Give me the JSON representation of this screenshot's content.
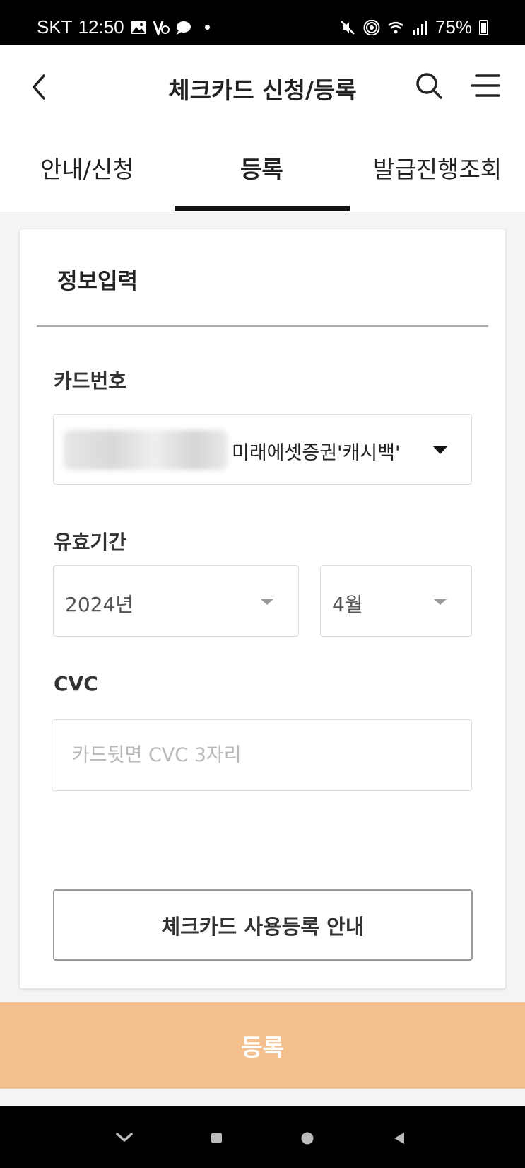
{
  "status_bar": {
    "carrier": "SKT",
    "time": "12:50",
    "battery": "75%",
    "left_icons": [
      "gallery-icon",
      "silent-mode-icon",
      "chat-bubble-icon",
      "notification-dot-icon"
    ],
    "right_icons": [
      "mute-icon",
      "hotspot-icon",
      "wifi-icon",
      "signal-icon",
      "battery-icon"
    ]
  },
  "header": {
    "title": "체크카드 신청/등록",
    "icons": [
      "back-icon",
      "search-icon",
      "menu-icon"
    ]
  },
  "tabs": [
    {
      "label": "안내/신청",
      "active": false
    },
    {
      "label": "등록",
      "active": true
    },
    {
      "label": "발급진행조회",
      "active": false
    }
  ],
  "form": {
    "section_title": "정보입력",
    "card_number": {
      "label": "카드번호",
      "selected_card_name": "미래에셋증권'캐시백'"
    },
    "expiry": {
      "label": "유효기간",
      "year": "2024년",
      "month": "4월"
    },
    "cvc": {
      "label": "CVC",
      "placeholder": "카드뒷면 CVC 3자리",
      "value": ""
    },
    "guide_button": "체크카드 사용등록 안내"
  },
  "submit_button": "등록",
  "colors": {
    "submit_bg": "#f3c08e",
    "tab_indicator": "#111111"
  },
  "nav_bar": {
    "icons": [
      "recents-chevron-icon",
      "home-square-icon",
      "circle-icon",
      "back-triangle-icon"
    ]
  }
}
